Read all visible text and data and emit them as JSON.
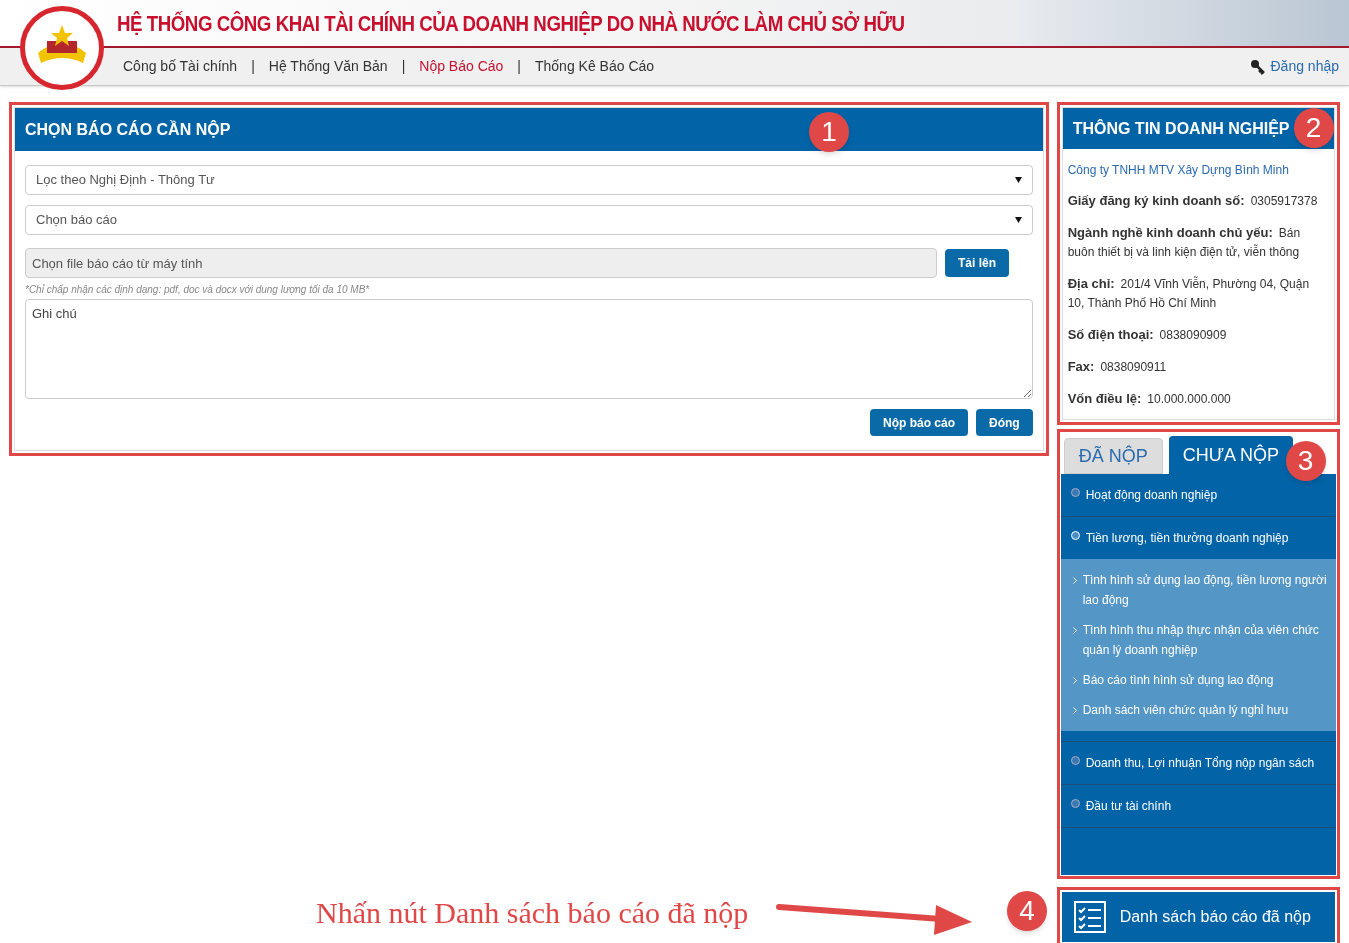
{
  "header": {
    "title": "HỆ THỐNG CÔNG KHAI TÀI CHÍNH CỦA DOANH NGHIỆP DO NHÀ NƯỚC LÀM CHỦ SỞ HỮU",
    "nav": [
      {
        "label": "Công bố Tài chính",
        "selected": false
      },
      {
        "label": "Hệ Thống Văn Bản",
        "selected": false
      },
      {
        "label": "Nộp Báo Cáo",
        "selected": true
      },
      {
        "label": "Thống Kê Báo Cáo",
        "selected": false
      }
    ],
    "separator": "|",
    "login": "Đăng nhập"
  },
  "report_form": {
    "title": "CHỌN BÁO CÁO CẦN NỘP",
    "marker": "1",
    "selects": [
      {
        "placeholder": "Lọc theo Nghị Định - Thông Tư"
      },
      {
        "placeholder": "Chọn báo cáo"
      }
    ],
    "file_field": {
      "placeholder": "Chọn file báo cáo từ máy tính"
    },
    "upload_button": "Tải lên",
    "note": "*Chỉ chấp nhận các định dạng: pdf, doc và docx với dung lượng tối đa 10 MB*",
    "notes_field": {
      "placeholder": "Ghi chú"
    },
    "buttons": [
      "Nộp báo cáo",
      "Đóng"
    ]
  },
  "company_info": {
    "title": "THÔNG TIN DOANH NGHIỆP",
    "marker": "2",
    "name": "Công ty TNHH MTV Xây Dựng Bình Minh",
    "fields": [
      {
        "label": "Giấy đăng ký kinh doanh số:",
        "value": "0305917378"
      },
      {
        "label": "Ngành nghề kinh doanh chủ yếu:",
        "value": "Bán buôn thiết bị và linh kiện điện tử, viễn thông"
      },
      {
        "label": "Địa chỉ:",
        "value": "201/4 Vĩnh Viễn, Phường 04, Quận 10, Thành Phố Hồ Chí Minh"
      },
      {
        "label": "Số điện thoại:",
        "value": "0838090909"
      },
      {
        "label": "Fax:",
        "value": "0838090911"
      },
      {
        "label": "Vốn điều lệ:",
        "value": "10.000.000.000"
      }
    ]
  },
  "report_tabs": {
    "marker": "3",
    "tabs": [
      {
        "label": "ĐÃ NỘP",
        "selected": false
      },
      {
        "label": "CHƯA NỘP",
        "selected": true
      }
    ],
    "items": [
      {
        "label": "Hoạt động doanh nghiệp",
        "expanded": false
      },
      {
        "label": "Tiền lương, tiền thưởng doanh nghiệp",
        "expanded": true,
        "children": [
          {
            "label": "Tình hình sử dụng lao động, tiền lương người lao động"
          },
          {
            "label": "Tình hình thu nhập thực nhận của viên chức quản lý doanh nghiệp"
          },
          {
            "label": "Báo cáo tình hình sử dụng lao động"
          },
          {
            "label": "Danh sách viên chức quản lý nghỉ hưu"
          }
        ]
      },
      {
        "label": "Doanh thu, Lợi nhuận Tổng nộp ngân sách",
        "expanded": false
      },
      {
        "label": "Đầu tư tài chính",
        "expanded": false
      }
    ]
  },
  "submitted_list_button": {
    "label": "Danh sách báo cáo đã nộp",
    "marker": "4"
  },
  "instruction": "Nhấn nút Danh sách báo cáo đã nộp"
}
